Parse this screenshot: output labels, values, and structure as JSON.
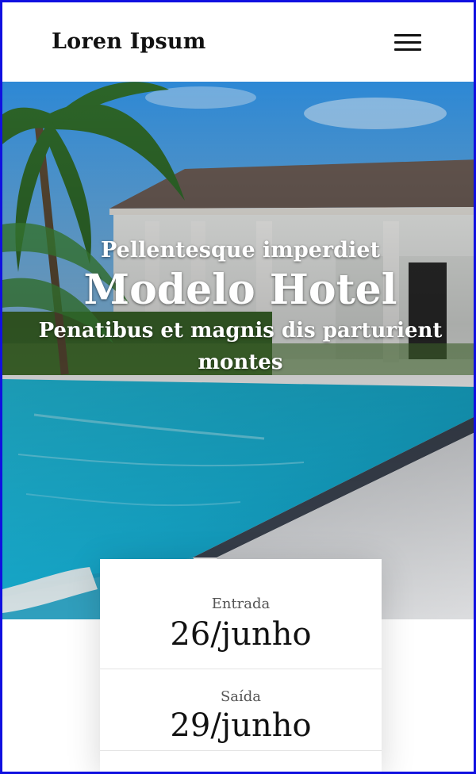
{
  "header": {
    "brand": "Loren Ipsum",
    "menu_icon": "hamburger-menu-icon"
  },
  "hero": {
    "subtitle": "Pellentesque imperdiet",
    "title": "Modelo Hotel",
    "tagline": "Penatibus et magnis dis parturient montes",
    "image": "hotel-pool-photo"
  },
  "booking": {
    "checkin_label": "Entrada",
    "checkin_value": "26/junho",
    "checkout_label": "Saída",
    "checkout_value": "29/junho"
  },
  "colors": {
    "frame_border": "#1010e0",
    "text_dark": "#111111",
    "label_gray": "#555555",
    "pool": "#1fb8d8",
    "sky": "#3a9be6"
  }
}
